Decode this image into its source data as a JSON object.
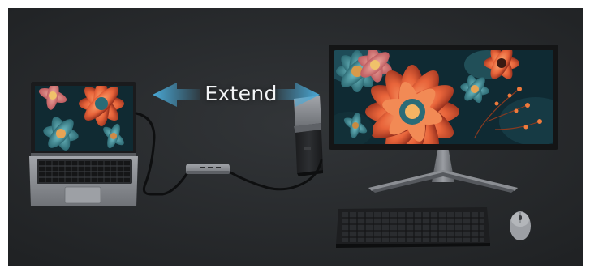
{
  "banner": {
    "extend_label": "Extend"
  },
  "colors": {
    "background": "#2a2c2e",
    "arrow": "#5fb6d8",
    "device_body": "#8d9095",
    "keyboard": "#1d1e20"
  },
  "objects": [
    "laptop",
    "usb-hub",
    "mini-pc",
    "monitor",
    "keyboard",
    "mouse",
    "double-arrow-icon"
  ]
}
